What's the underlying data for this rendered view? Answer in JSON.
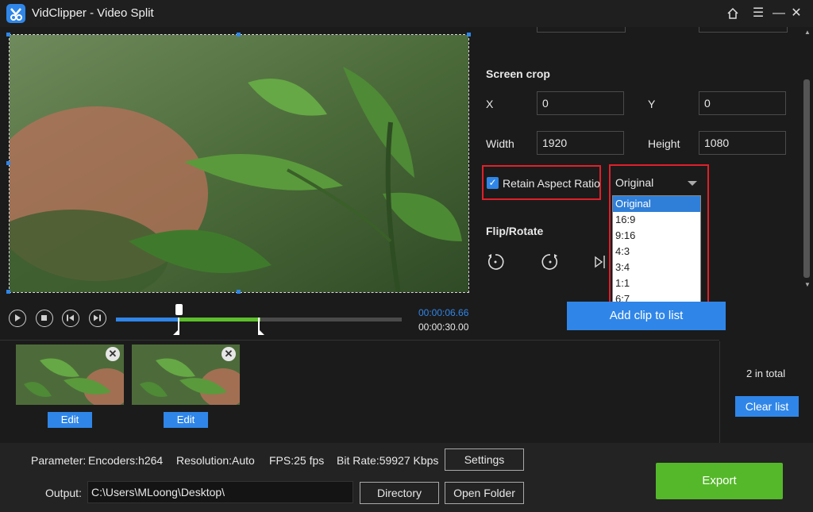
{
  "window": {
    "title": "VidClipper - Video Split"
  },
  "player": {
    "current_time": "00:00:06.66",
    "total_time": "00:00:30.00"
  },
  "screen_crop": {
    "heading": "Screen crop",
    "x_label": "X",
    "x_value": "0",
    "y_label": "Y",
    "y_value": "0",
    "width_label": "Width",
    "width_value": "1920",
    "height_label": "Height",
    "height_value": "1080",
    "retain_label": "Retain Aspect Ratio",
    "ratio_selected": "Original",
    "ratio_options": [
      "Original",
      "16:9",
      "9:16",
      "4:3",
      "3:4",
      "1:1",
      "6:7"
    ]
  },
  "flip_rotate": {
    "heading": "Flip/Rotate"
  },
  "add_clip_label": "Add clip to list",
  "clips": {
    "edit_label": "Edit",
    "count_text": "2 in total",
    "clear_label": "Clear list"
  },
  "bottom": {
    "parameter_label": "Parameter:",
    "encoders": "Encoders:h264",
    "resolution": "Resolution:Auto",
    "fps": "FPS:25 fps",
    "bitrate": "Bit Rate:59927 Kbps",
    "settings_label": "Settings",
    "output_label": "Output:",
    "output_path": "C:\\Users\\MLoong\\Desktop\\",
    "directory_label": "Directory",
    "open_folder_label": "Open Folder",
    "export_label": "Export"
  },
  "colors": {
    "accent": "#2f86e8",
    "export": "#55b82a",
    "highlight": "#e0202a"
  }
}
